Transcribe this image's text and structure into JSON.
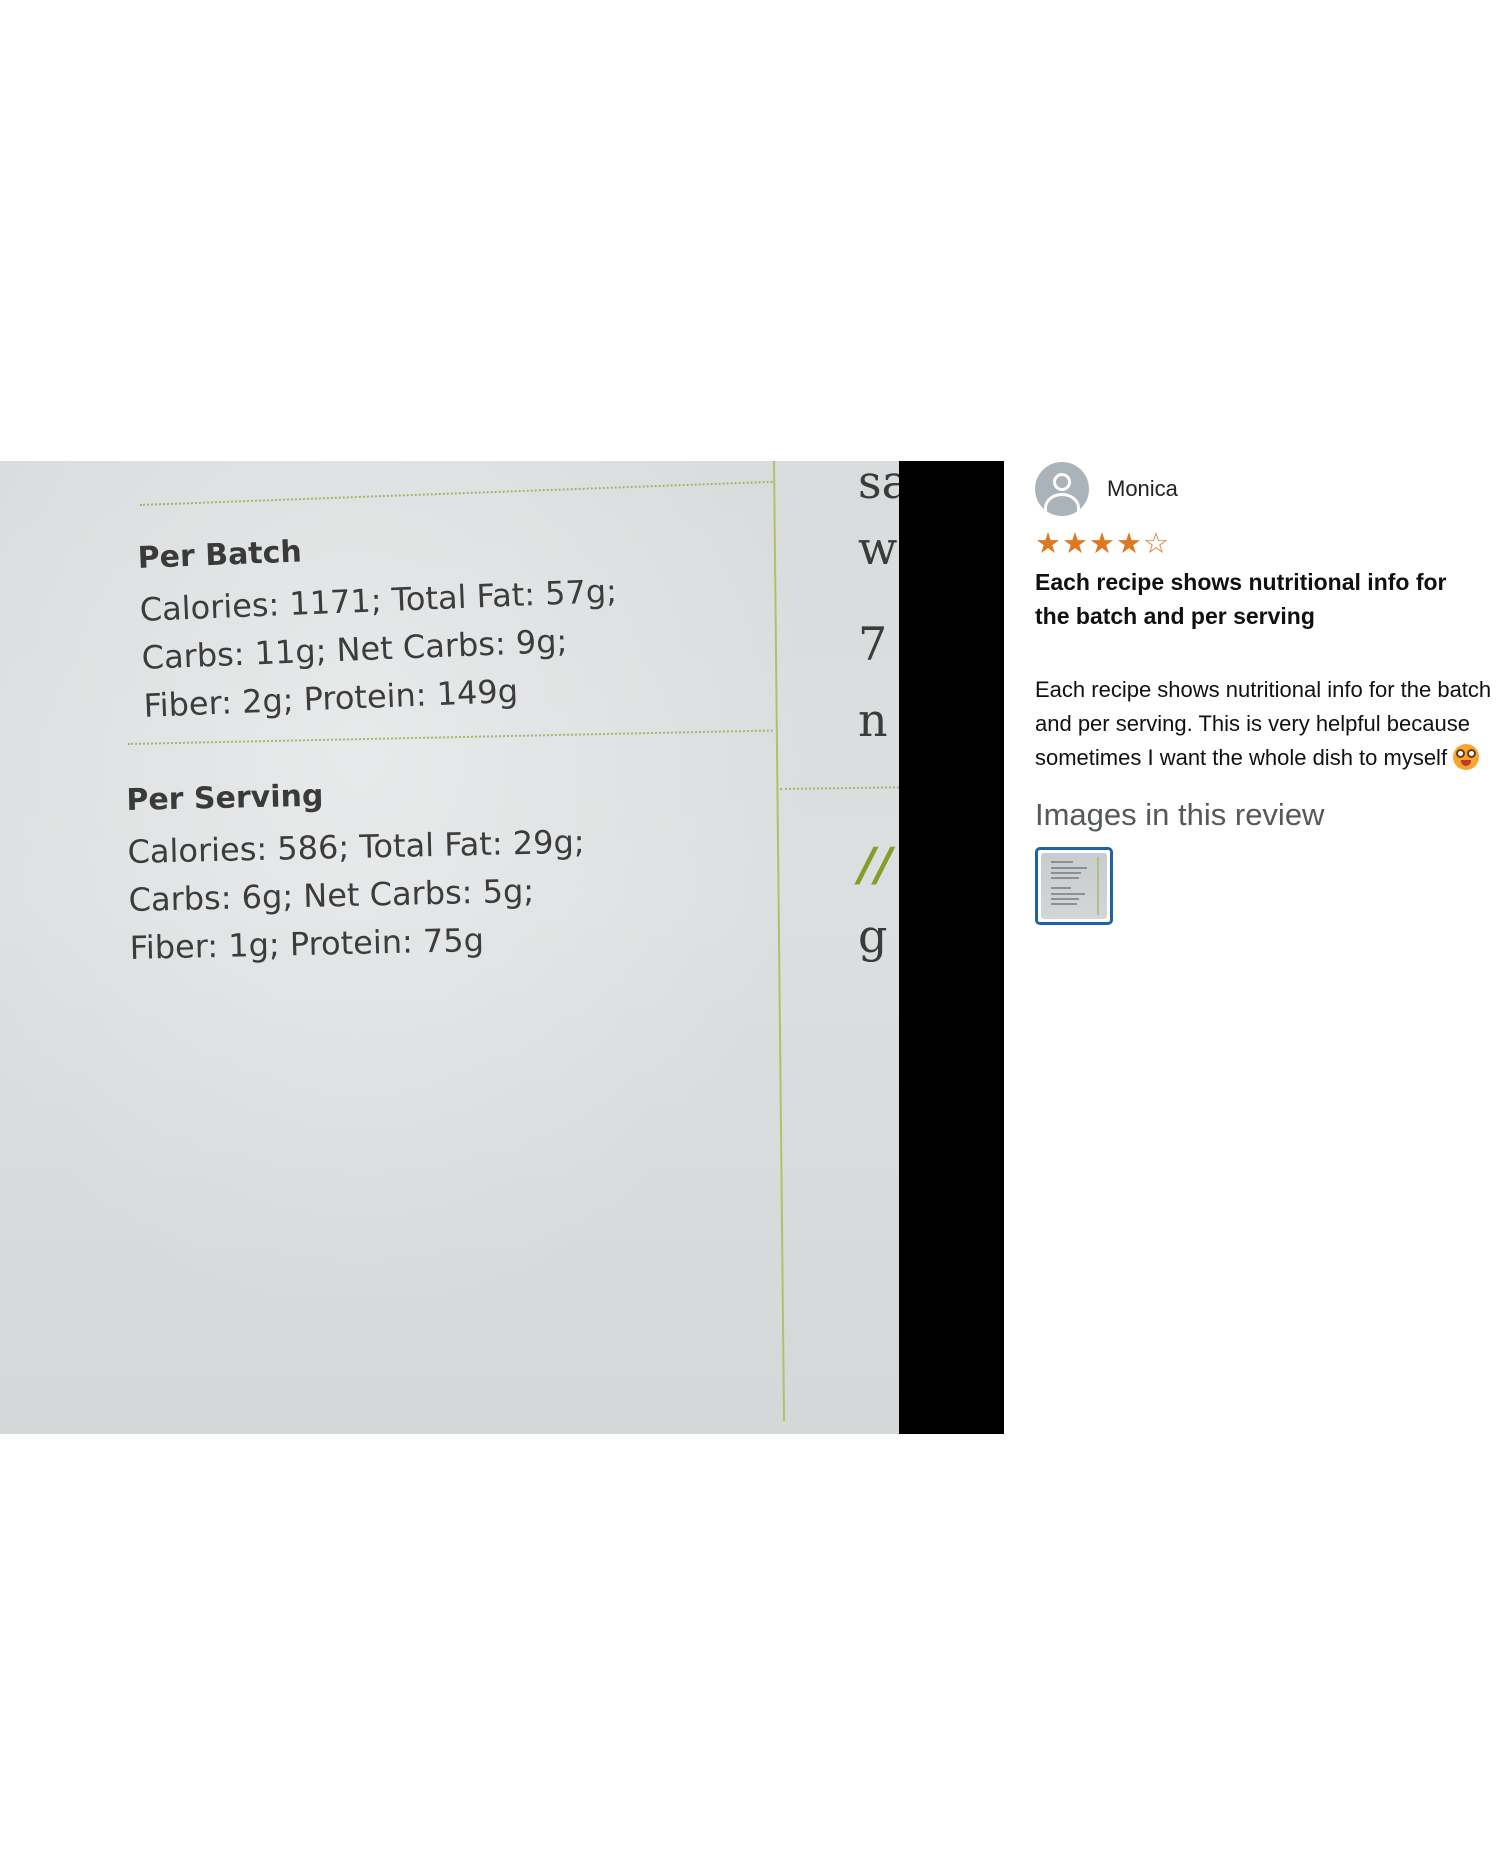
{
  "photo": {
    "per_batch": {
      "title": "Per Batch",
      "lines": [
        "Calories: 1171; Total Fat: 57g;",
        "Carbs: 11g; Net Carbs: 9g;",
        "Fiber: 2g; Protein: 149g"
      ]
    },
    "per_serving": {
      "title": "Per Serving",
      "lines": [
        "Calories: 586; Total Fat: 29g;",
        "Carbs: 6g; Net Carbs: 5g;",
        "Fiber: 1g; Protein: 75g"
      ]
    },
    "edge_letters": [
      "sa",
      "w",
      "7",
      "n",
      "//",
      "g"
    ]
  },
  "review": {
    "reviewer_name": "Monica",
    "rating": 4,
    "rating_max": 5,
    "title": "Each recipe shows nutritional info for the batch and per serving",
    "body": "Each recipe shows nutritional info for the batch and per serving. This is very helpful because sometimes I want the whole dish to myself",
    "images_heading": "Images in this review"
  },
  "colors": {
    "star": "#de7921",
    "thumb_border": "#2162a1",
    "accent_line": "#b4bf6a"
  }
}
